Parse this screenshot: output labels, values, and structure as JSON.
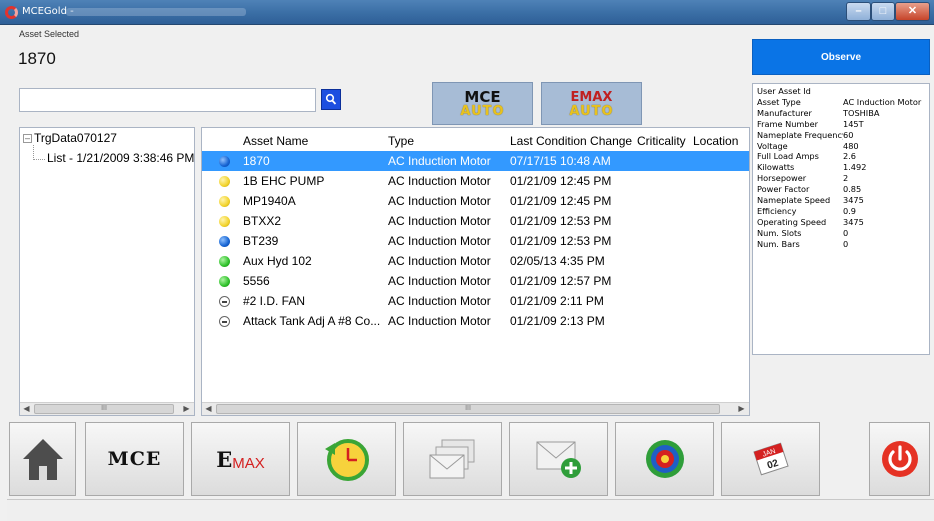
{
  "window": {
    "title": "MCEGold -"
  },
  "asset": {
    "label": "Asset Selected",
    "value": "1870"
  },
  "observe_label": "Observe",
  "search": {
    "value": "",
    "placeholder": ""
  },
  "auto_buttons": {
    "mce": {
      "top": "MCE",
      "bottom": "AUTO"
    },
    "emax": {
      "top": "EMAX",
      "bottom": "AUTO"
    }
  },
  "properties": [
    {
      "key": "User Asset Id",
      "value": ""
    },
    {
      "key": "Asset Type",
      "value": "AC Induction Motor"
    },
    {
      "key": "Manufacturer",
      "value": "TOSHIBA"
    },
    {
      "key": "Frame Number",
      "value": "145T"
    },
    {
      "key": "Nameplate Frequency",
      "value": "60"
    },
    {
      "key": "Voltage",
      "value": "480"
    },
    {
      "key": "Full Load Amps",
      "value": "2.6"
    },
    {
      "key": "Kilowatts",
      "value": "1.492"
    },
    {
      "key": "Horsepower",
      "value": "2"
    },
    {
      "key": "Power Factor",
      "value": "0.85"
    },
    {
      "key": "Nameplate Speed",
      "value": "3475"
    },
    {
      "key": "Efficiency",
      "value": "0.9"
    },
    {
      "key": "Operating Speed",
      "value": "3475"
    },
    {
      "key": "Num. Slots",
      "value": "0"
    },
    {
      "key": "Num. Bars",
      "value": "0"
    }
  ],
  "tree": {
    "root": "TrgData070127",
    "child": "List - 1/21/2009 3:38:46 PM"
  },
  "table": {
    "headers": {
      "name": "Asset Name",
      "type": "Type",
      "change": "Last Condition Change",
      "criticality": "Criticality",
      "location": "Location"
    },
    "rows": [
      {
        "status": "blue",
        "name": "1870",
        "type": "AC Induction Motor",
        "change": "07/17/15 10:48 AM"
      },
      {
        "status": "yellow",
        "name": "1B EHC PUMP",
        "type": "AC Induction Motor",
        "change": "01/21/09 12:45 PM"
      },
      {
        "status": "yellow",
        "name": "MP1940A",
        "type": "AC Induction Motor",
        "change": "01/21/09 12:45 PM"
      },
      {
        "status": "yellow",
        "name": "BTXX2",
        "type": "AC Induction Motor",
        "change": "01/21/09 12:53 PM"
      },
      {
        "status": "blue",
        "name": "BT239",
        "type": "AC Induction Motor",
        "change": "01/21/09 12:53 PM"
      },
      {
        "status": "green",
        "name": "Aux Hyd 102",
        "type": "AC Induction Motor",
        "change": "02/05/13 4:35 PM"
      },
      {
        "status": "green",
        "name": "5556",
        "type": "AC Induction Motor",
        "change": "01/21/09 12:57 PM"
      },
      {
        "status": "minus",
        "name": "#2 I.D. FAN",
        "type": "AC Induction Motor",
        "change": "01/21/09 2:11 PM"
      },
      {
        "status": "minus",
        "name": "Attack Tank Adj A #8 Co...",
        "type": "AC Induction Motor",
        "change": "01/21/09 2:13 PM"
      }
    ],
    "selected_index": 0
  },
  "toolbar": {
    "mce_label": "MCE",
    "emax_label_e": "E",
    "emax_label_rest": "MAX",
    "calendar_month": "JAN",
    "calendar_day": "02"
  },
  "scrollbar_glyph": "III"
}
